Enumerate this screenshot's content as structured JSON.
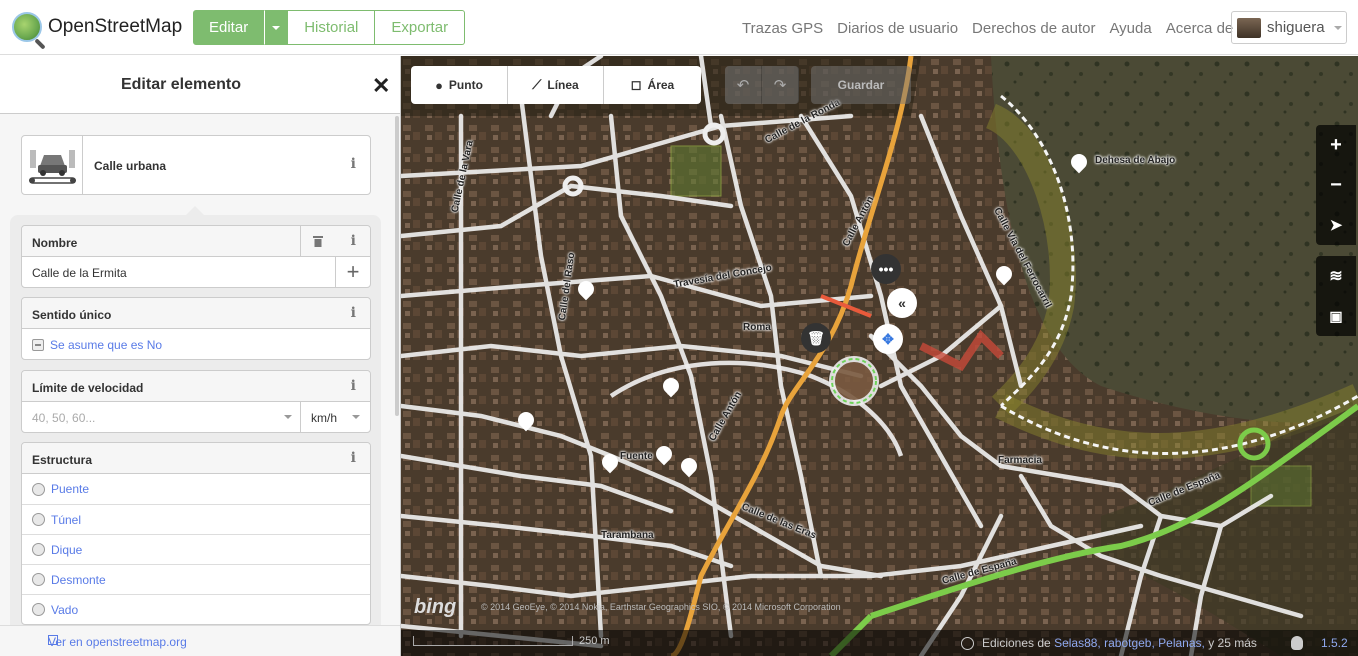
{
  "header": {
    "logo_text": "OpenStreetMap",
    "edit_label": "Editar",
    "history_label": "Historial",
    "export_label": "Exportar",
    "nav": [
      "Trazas GPS",
      "Diarios de usuario",
      "Derechos de autor",
      "Ayuda",
      "Acerca de"
    ],
    "username": "shiguera"
  },
  "sidebar": {
    "title": "Editar elemento",
    "preset_name": "Calle urbana",
    "fields": {
      "name_label": "Nombre",
      "name_value": "Calle de la Ermita",
      "oneway_label": "Sentido único",
      "oneway_value": "Se asume que es No",
      "maxspeed_label": "Límite de velocidad",
      "maxspeed_placeholder": "40, 50, 60...",
      "maxspeed_unit": "km/h",
      "structure_label": "Estructura",
      "structure_options": [
        "Puente",
        "Túnel",
        "Dique",
        "Desmonte",
        "Vado"
      ]
    },
    "footer_link": "Ver en openstreetmap.org"
  },
  "map": {
    "tools": {
      "point": "Punto",
      "line": "Línea",
      "area": "Área",
      "save": "Guardar"
    },
    "labels": {
      "dehesa": "Dehesa de Abajo",
      "via_ferrea": "Calle Vía del Ferrocarril",
      "rodaguardar": "Calle de la Ronda",
      "vara": "Calle de la Vara",
      "raso": "Calle del Raso",
      "anton_top": "Calle Antón",
      "anton_bottom": "Calle Antón",
      "concejo": "Travesía del Concejo",
      "roma": "Roma",
      "fuente": "Fuente",
      "farmacia": "Farmacia",
      "eras": "Calle de las Eras",
      "tarambana": "Tarambana",
      "espana_right": "Calle de España",
      "espana_bottom": "Calle de España"
    },
    "attribution": "© 2014 GeoEye, © 2014 Nokia, Earthstar Geographics SIO, © 2014 Microsoft Corporation",
    "bing": "bing",
    "scale": "250 m",
    "edits_prefix": "Ediciones de",
    "editors": "Selas88, rabotgeb, Pelanas,",
    "edits_suffix": "y 25 más",
    "version": "1.5.2"
  },
  "colors": {
    "accent": "#7ebc6f",
    "link": "#597be7"
  }
}
